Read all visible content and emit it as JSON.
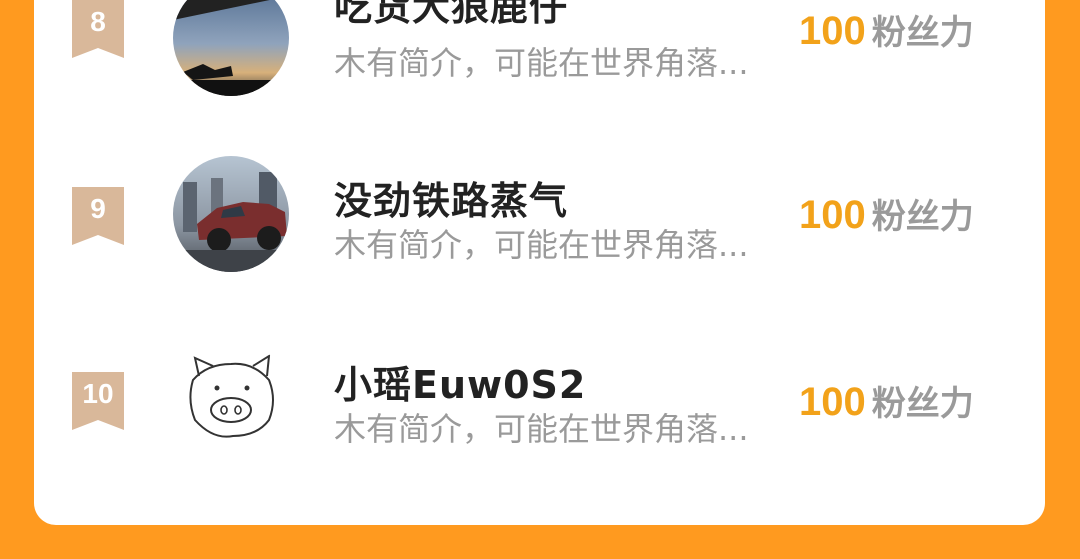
{
  "colors": {
    "background": "#FF9A1F",
    "card": "#FFFFFF",
    "rank_badge": "#D9B89A",
    "score": "#F2A21A",
    "name": "#222222",
    "muted": "#9A9A9A"
  },
  "rows": [
    {
      "rank": "8",
      "name": "吃货大狼鹿仔",
      "bio": "木有简介，可能在世界角落...",
      "score": "100",
      "score_unit": "粉丝力",
      "avatar_icon": "sunset-sky-avatar"
    },
    {
      "rank": "9",
      "name": "没劲铁路蒸气",
      "bio": "木有简介，可能在世界角落...",
      "score": "100",
      "score_unit": "粉丝力",
      "avatar_icon": "red-pickup-truck-avatar"
    },
    {
      "rank": "10",
      "name": "小瑶Euw0S2",
      "bio": "木有简介，可能在世界角落...",
      "score": "100",
      "score_unit": "粉丝力",
      "avatar_icon": "pig-sketch-avatar"
    }
  ]
}
